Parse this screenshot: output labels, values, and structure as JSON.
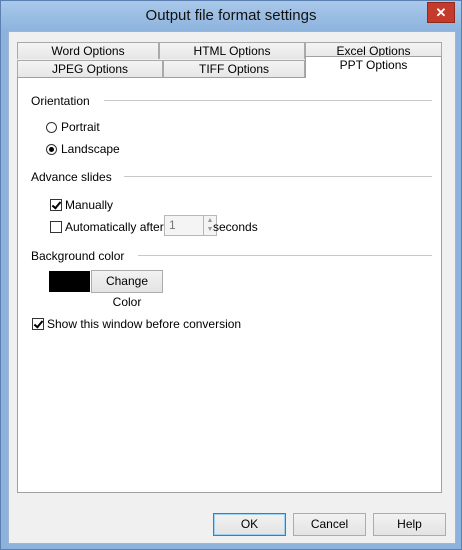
{
  "window": {
    "title": "Output file format settings",
    "close_glyph": "✕"
  },
  "tabs_row1": [
    "Word Options",
    "HTML Options",
    "Excel Options"
  ],
  "tabs_row2": [
    "JPEG Options",
    "TIFF Options",
    "PPT Options"
  ],
  "active_tab": "PPT Options",
  "orientation": {
    "label": "Orientation",
    "options": [
      {
        "label": "Portrait",
        "checked": false
      },
      {
        "label": "Landscape",
        "checked": true
      }
    ]
  },
  "advance_slides": {
    "label": "Advance slides",
    "manually": {
      "label": "Manually",
      "checked": true
    },
    "automatic": {
      "label": "Automatically after",
      "checked": false,
      "value": "1",
      "unit": "seconds"
    }
  },
  "background": {
    "label": "Background color",
    "color": "#000000",
    "button": "Change Color"
  },
  "show_window": {
    "label": "Show this window before conversion",
    "checked": true
  },
  "buttons": {
    "ok": "OK",
    "cancel": "Cancel",
    "help": "Help"
  }
}
